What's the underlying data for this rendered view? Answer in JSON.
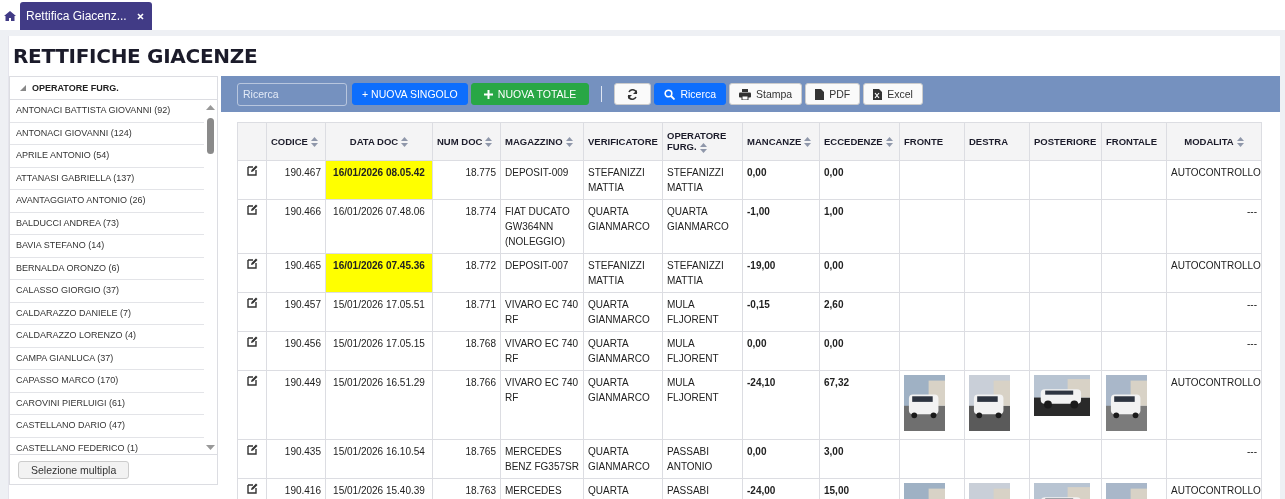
{
  "tabs": [
    {
      "label": "Rettifica Giacenz...",
      "selected": true
    }
  ],
  "page_title": "RETTIFICHE GIACENZE",
  "sidebar": {
    "header": "OPERATORE FURG.",
    "items": [
      {
        "label": "ANTONACI BATTISTA GIOVANNI (92)"
      },
      {
        "label": "ANTONACI GIOVANNI (124)"
      },
      {
        "label": "APRILE ANTONIO (54)"
      },
      {
        "label": "ATTANASI GABRIELLA (137)"
      },
      {
        "label": "AVANTAGGIATO ANTONIO (26)"
      },
      {
        "label": "BALDUCCI ANDREA (73)"
      },
      {
        "label": "BAVIA STEFANO (14)"
      },
      {
        "label": "BERNALDA ORONZO (6)"
      },
      {
        "label": "CALASSO GIORGIO (37)"
      },
      {
        "label": "CALDARAZZO DANIELE (7)"
      },
      {
        "label": "CALDARAZZO LORENZO (4)"
      },
      {
        "label": "CAMPA GIANLUCA (37)"
      },
      {
        "label": "CAPASSO MARCO (170)"
      },
      {
        "label": "CAROVINI PIERLUIGI (61)"
      },
      {
        "label": "CASTELLANO DARIO (47)"
      },
      {
        "label": "CASTELLANO FEDERICO (1)"
      }
    ],
    "multi_select_button": "Selezione multipla"
  },
  "toolbar": {
    "search_placeholder": "Ricerca",
    "new_single": "+ NUOVA SINGOLO",
    "new_total": "NUOVA TOTALE",
    "search_button": "Ricerca",
    "print_button": "Stampa",
    "pdf_button": "PDF",
    "excel_button": "Excel"
  },
  "table": {
    "columns": [
      {
        "sortable": false
      },
      {
        "label": "CODICE",
        "sortable": true
      },
      {
        "label": "DATA DOC",
        "sortable": true
      },
      {
        "label": "NUM DOC",
        "sortable": true
      },
      {
        "label": "MAGAZZINO",
        "sortable": true
      },
      {
        "label": "VERIFICATORE",
        "sortable": false
      },
      {
        "label": "OPERATORE FURG.",
        "sortable": true
      },
      {
        "label": "MANCANZE",
        "sortable": true
      },
      {
        "label": "ECCEDENZE",
        "sortable": true
      },
      {
        "label": "FRONTE",
        "sortable": false
      },
      {
        "label": "DESTRA",
        "sortable": false
      },
      {
        "label": "POSTERIORE",
        "sortable": false
      },
      {
        "label": "FRONTALE",
        "sortable": false
      },
      {
        "label": "MODALITA",
        "sortable": true
      }
    ],
    "rows": [
      {
        "codice": "190.467",
        "data_doc": "16/01/2026 08.05.42",
        "highlighted": true,
        "num_doc": "18.775",
        "magazzino": "DEPOSIT-009",
        "verificatore": "STEFANIZZI MATTIA",
        "operatore": "STEFANIZZI MATTIA",
        "mancanze": "0,00",
        "eccedenze": "0,00",
        "photos": false,
        "modalita": "AUTOCONTROLLO"
      },
      {
        "codice": "190.466",
        "data_doc": "16/01/2026 07.48.06",
        "highlighted": false,
        "num_doc": "18.774",
        "magazzino": "FIAT DUCATO GW364NN (NOLEGGIO)",
        "verificatore": "QUARTA GIANMARCO",
        "operatore": "QUARTA GIANMARCO",
        "mancanze": "-1,00",
        "eccedenze": "1,00",
        "photos": false,
        "modalita": "---"
      },
      {
        "codice": "190.465",
        "data_doc": "16/01/2026 07.45.36",
        "highlighted": true,
        "num_doc": "18.772",
        "magazzino": "DEPOSIT-007",
        "verificatore": "STEFANIZZI MATTIA",
        "operatore": "STEFANIZZI MATTIA",
        "mancanze": "-19,00",
        "eccedenze": "0,00",
        "photos": false,
        "modalita": "AUTOCONTROLLO"
      },
      {
        "codice": "190.457",
        "data_doc": "15/01/2026 17.05.51",
        "highlighted": false,
        "num_doc": "18.771",
        "magazzino": "VIVARO EC 740 RF",
        "verificatore": "QUARTA GIANMARCO",
        "operatore": "MULA FLJORENT",
        "mancanze": "-0,15",
        "eccedenze": "2,60",
        "photos": false,
        "modalita": "---"
      },
      {
        "codice": "190.456",
        "data_doc": "15/01/2026 17.05.15",
        "highlighted": false,
        "num_doc": "18.768",
        "magazzino": "VIVARO EC 740 RF",
        "verificatore": "QUARTA GIANMARCO",
        "operatore": "MULA FLJORENT",
        "mancanze": "0,00",
        "eccedenze": "0,00",
        "photos": false,
        "modalita": "---"
      },
      {
        "codice": "190.449",
        "data_doc": "15/01/2026 16.51.29",
        "highlighted": false,
        "num_doc": "18.766",
        "magazzino": "VIVARO EC 740 RF",
        "verificatore": "QUARTA GIANMARCO",
        "operatore": "MULA FLJORENT",
        "mancanze": "-24,10",
        "eccedenze": "67,32",
        "photos": true,
        "modalita": "AUTOCONTROLLO"
      },
      {
        "codice": "190.435",
        "data_doc": "15/01/2026 16.10.54",
        "highlighted": false,
        "num_doc": "18.765",
        "magazzino": "MERCEDES BENZ FG357SR",
        "verificatore": "QUARTA GIANMARCO",
        "operatore": "PASSABI ANTONIO",
        "mancanze": "0,00",
        "eccedenze": "3,00",
        "photos": false,
        "modalita": "---"
      },
      {
        "codice": "190.416",
        "data_doc": "15/01/2026 15.40.39",
        "highlighted": false,
        "num_doc": "18.763",
        "magazzino": "MERCEDES",
        "verificatore": "QUARTA",
        "operatore": "PASSABI",
        "mancanze": "-24,00",
        "eccedenze": "15,00",
        "photos": true,
        "modalita": "AUTOCONTROLLO"
      }
    ]
  }
}
